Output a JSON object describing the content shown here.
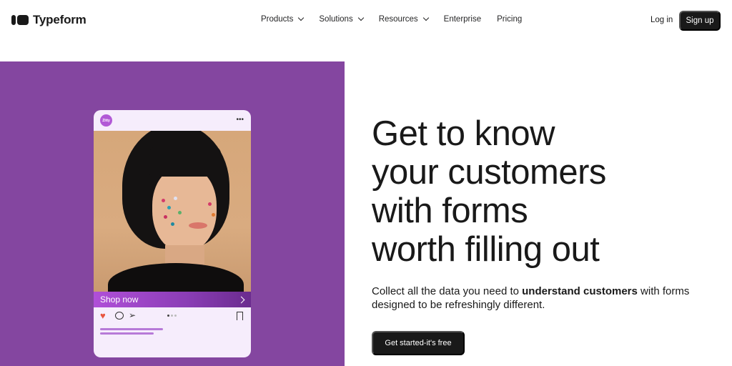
{
  "nav": {
    "brand": "Typeform",
    "menu": [
      {
        "label": "Products",
        "has_dropdown": true
      },
      {
        "label": "Solutions",
        "has_dropdown": true
      },
      {
        "label": "Resources",
        "has_dropdown": true
      },
      {
        "label": "Enterprise",
        "has_dropdown": false
      },
      {
        "label": "Pricing",
        "has_dropdown": false
      }
    ],
    "login_label": "Log in",
    "signup_label": "Sign up"
  },
  "hero": {
    "panel_color": "#8446a0",
    "card": {
      "avatar_text": "Zitty",
      "more_icon": "more-horizontal-icon",
      "shop_label": "Shop now",
      "actions": [
        "heart-icon",
        "comment-icon",
        "send-icon",
        "bookmark-icon"
      ],
      "carousel_dots": 3,
      "carousel_active": 1
    },
    "headline_lines": [
      "Get to know",
      "your customers",
      "with forms",
      "worth filling out"
    ],
    "subtext_before": "Collect all the data you need to ",
    "subtext_bold": "understand customers",
    "subtext_after": " with forms designed to be refreshingly different.",
    "cta_label": "Get started-it's free"
  }
}
